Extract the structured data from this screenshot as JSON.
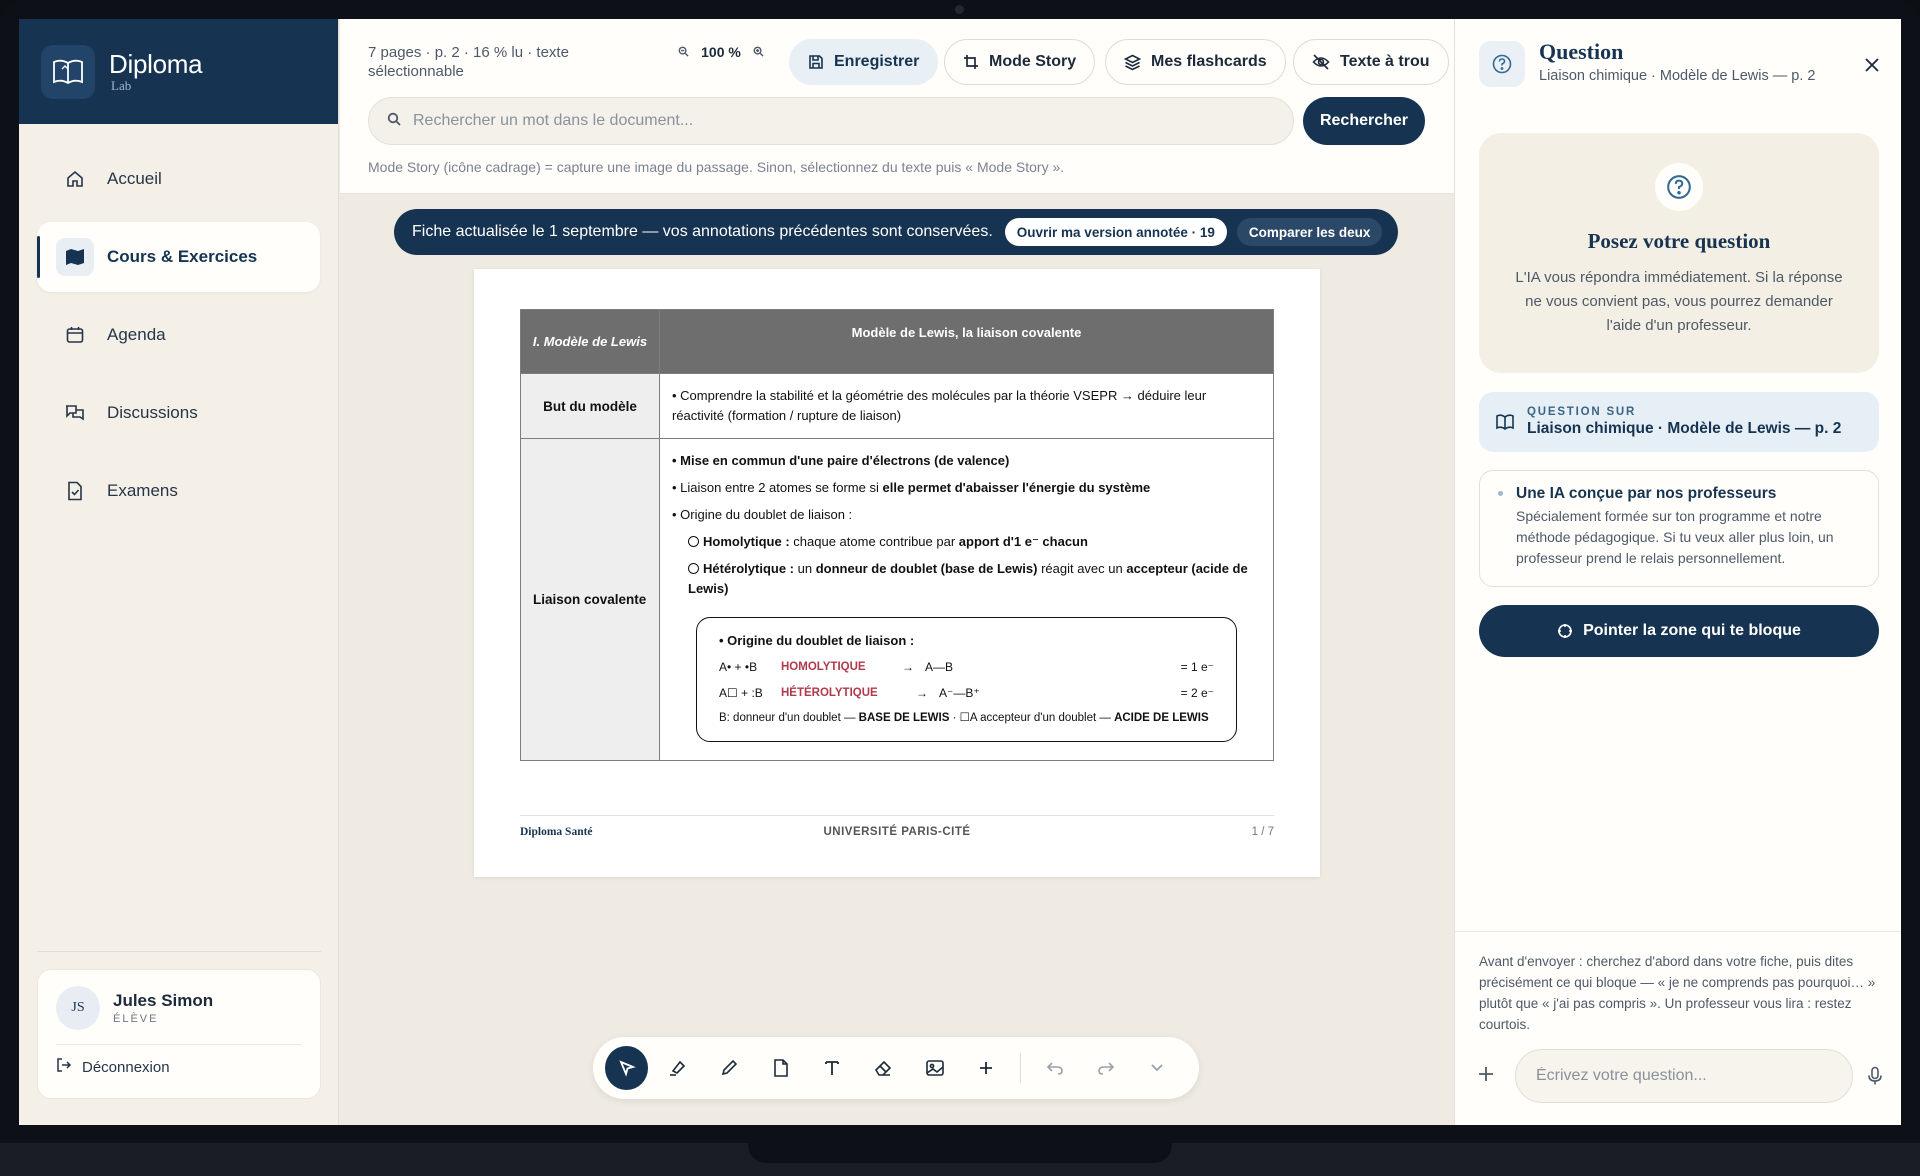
{
  "brand": {
    "name": "Diploma",
    "sub": "Lab"
  },
  "sidebar": {
    "items": [
      {
        "label": "Accueil",
        "icon": "home-icon"
      },
      {
        "label": "Cours & Exercices",
        "icon": "map-icon",
        "active": true
      },
      {
        "label": "Agenda",
        "icon": "calendar-icon"
      },
      {
        "label": "Discussions",
        "icon": "chat-icon"
      },
      {
        "label": "Examens",
        "icon": "exam-icon"
      }
    ]
  },
  "user": {
    "initials": "JS",
    "name": "Jules Simon",
    "role": "ÉLÈVE",
    "logout": "Déconnexion"
  },
  "topbar": {
    "meta": "7 pages · p. 2 · 16 % lu · texte sélectionnable",
    "zoom": "100 %",
    "buttons": {
      "save": "Enregistrer",
      "story": "Mode Story",
      "flashcards": "Mes flashcards",
      "holes": "Texte à trou"
    },
    "search_placeholder": "Rechercher un mot dans le document...",
    "search_button": "Rechercher",
    "hint": "Mode Story (icône cadrage) = capture une image du passage. Sinon, sélectionnez du texte puis « Mode Story »."
  },
  "banner": {
    "text": "Fiche actualisée le 1 septembre — vos annotations précédentes sont conservées.",
    "open": "Ouvrir ma version annotée · 19",
    "compare": "Comparer les deux"
  },
  "document": {
    "header_left": "I. Modèle de Lewis",
    "header_right": "Modèle de Lewis, la liaison covalente",
    "row1_label": "But du modèle",
    "row1_text": "• Comprendre la stabilité et la géométrie des molécules par la théorie VSEPR → déduire leur réactivité (formation / rupture de liaison)",
    "row2_label": "Liaison covalente",
    "b1": "• Mise en commun d'une paire d'électrons (de valence)",
    "b2_pre": "• Liaison entre 2 atomes se forme si ",
    "b2_bold": "elle permet d'abaisser l'énergie du système",
    "b3": "• Origine du doublet de liaison :",
    "s1_bold": "Homolytique :",
    "s1_mid": " chaque atome contribue par ",
    "s1_bold2": "apport d'1 e⁻ chacun",
    "s2_bold": "Hétérolytique :",
    "s2_mid": " un ",
    "s2_bold2": "donneur de doublet (base de Lewis)",
    "s2_mid2": " réagit avec un ",
    "s2_bold3": "accepteur (acide de Lewis)",
    "box_title": "• Origine du doublet de liaison :",
    "eq1": {
      "left": "A• + •B",
      "kind": "HOMOLYTIQUE",
      "arrow": "→",
      "right": "A—B",
      "n": "= 1 e⁻"
    },
    "eq2": {
      "left": "A☐ + :B",
      "kind": "HÉTÉROLYTIQUE",
      "arrow": "→",
      "right": "A⁻—B⁺",
      "n": "= 2 e⁻"
    },
    "box_note_pre": "B: donneur d'un doublet — ",
    "box_note_b1": "BASE DE LEWIS",
    "box_note_mid": " · ☐A accepteur d'un doublet — ",
    "box_note_b2": "ACIDE DE LEWIS",
    "footer_left": "Diploma Santé",
    "footer_center": "UNIVERSITÉ PARIS-CITÉ",
    "footer_right": "1 / 7"
  },
  "panel": {
    "title": "Question",
    "subtitle": "Liaison chimique · Modèle de Lewis — p. 2",
    "ask_title": "Posez votre question",
    "ask_text": "L'IA vous répondra immédiatement. Si la réponse ne vous convient pas, vous pourrez demander l'aide d'un professeur.",
    "qs_label": "QUESTION SUR",
    "qs_value": "Liaison chimique · Modèle de Lewis — p. 2",
    "ia_title": "Une IA conçue par nos professeurs",
    "ia_text": "Spécialement formée sur ton programme et notre méthode pédagogique. Si tu veux aller plus loin, un professeur prend le relais personnellement.",
    "point_button": "Pointer la zone qui te bloque",
    "note": "Avant d'envoyer : cherchez d'abord dans votre fiche, puis dites précisément ce qui bloque — « je ne comprends pas pourquoi… » plutôt que « j'ai pas compris ». Un professeur vous lira : restez courtois.",
    "input_placeholder": "Écrivez votre question..."
  },
  "colors": {
    "navy": "#163452",
    "accent_red": "#b03a4c",
    "cream": "#efebe2"
  }
}
